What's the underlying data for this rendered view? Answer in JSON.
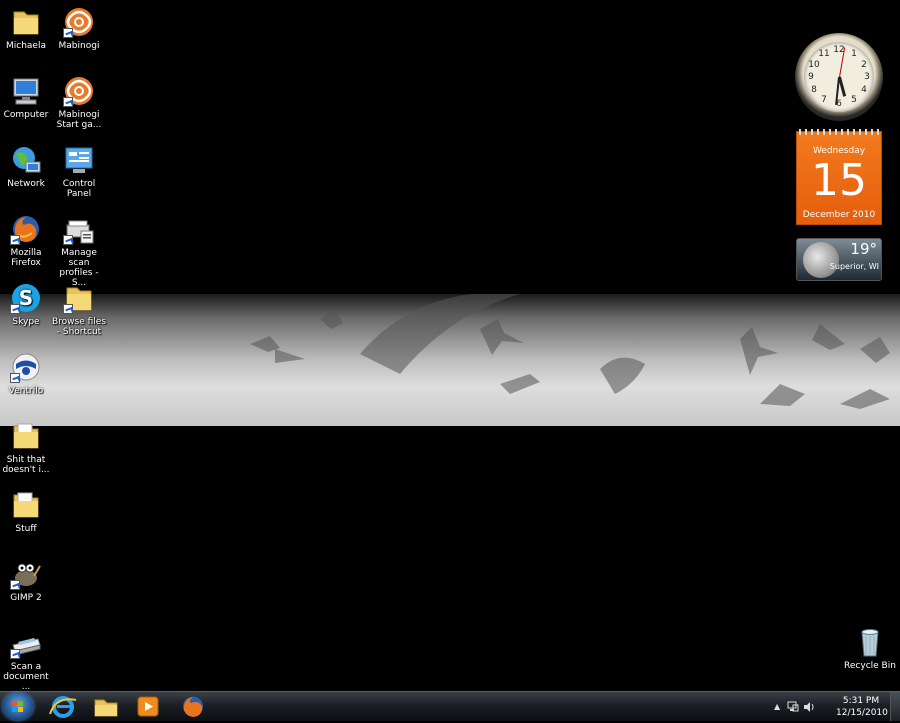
{
  "desktop": {
    "icons": [
      {
        "label": "Michaela",
        "icon": "folder-icon"
      },
      {
        "label": "Mabinogi",
        "icon": "mabinogi-icon"
      },
      {
        "label": "Computer",
        "icon": "computer-icon"
      },
      {
        "label": "Mabinogi Start ga...",
        "icon": "mabinogi-icon"
      },
      {
        "label": "Network",
        "icon": "network-icon"
      },
      {
        "label": "Control Panel",
        "icon": "control-panel-icon"
      },
      {
        "label": "Mozilla Firefox",
        "icon": "firefox-icon"
      },
      {
        "label": "Manage scan profiles - S...",
        "icon": "scan-profiles-icon"
      },
      {
        "label": "Skype",
        "icon": "skype-icon"
      },
      {
        "label": "Browse files - Shortcut",
        "icon": "folder-icon"
      },
      {
        "label": "Ventrilo",
        "icon": "ventrilo-icon"
      },
      {
        "label": "Shit that doesn't i...",
        "icon": "folder-icon"
      },
      {
        "label": "Stuff",
        "icon": "folder-icon"
      },
      {
        "label": "GIMP 2",
        "icon": "gimp-icon"
      },
      {
        "label": "Scan a document ...",
        "icon": "scanner-icon"
      },
      {
        "label": "Recycle Bin",
        "icon": "recycle-bin-icon"
      }
    ]
  },
  "gadgets": {
    "clock": {
      "numbers": [
        "12",
        "1",
        "2",
        "3",
        "4",
        "5",
        "6",
        "7",
        "8",
        "9",
        "10",
        "11"
      ]
    },
    "calendar": {
      "weekday": "Wednesday",
      "day": "15",
      "month_year": "December 2010"
    },
    "weather": {
      "temperature": "19°",
      "location": "Superior, WI"
    }
  },
  "taskbar": {
    "pinned": [
      {
        "name": "internet-explorer-icon"
      },
      {
        "name": "windows-explorer-icon"
      },
      {
        "name": "media-player-icon"
      },
      {
        "name": "firefox-icon"
      }
    ],
    "time": "5:31 PM",
    "date": "12/15/2010"
  },
  "colors": {
    "calendar_orange": "#ee6f16",
    "taskbar": "#1c2025",
    "desktop": "#000000"
  }
}
